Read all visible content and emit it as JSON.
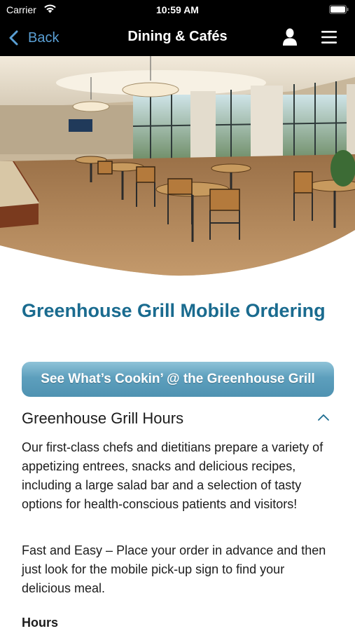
{
  "status_bar": {
    "carrier": "Carrier",
    "time": "10:59 AM",
    "icons": [
      "wifi-icon",
      "battery-icon"
    ]
  },
  "nav": {
    "back_label": "Back",
    "title": "Dining & Cafés",
    "icons": [
      "chevron-left-icon",
      "profile-icon",
      "menu-icon"
    ],
    "accent_color": "#5a9fd4"
  },
  "hero": {
    "description_icon": "cafeteria-photo"
  },
  "content": {
    "heading": "Greenhouse Grill Mobile Ordering",
    "heading_color": "#1a6b8f",
    "cta_label": "See What’s Cookin’ @ the Greenhouse Grill",
    "accordion": {
      "title": "Greenhouse Grill Hours",
      "expanded": true,
      "icon": "chevron-up-icon"
    },
    "paragraph_1": "Our first-class chefs and dietitians prepare a variety of appetizing entrees, snacks and delicious recipes, including a large salad bar and a selection of tasty options for health-conscious patients and visitors!",
    "paragraph_2": "Fast and Easy – Place your order in advance and then just look for the mobile pick-up sign to find your delicious meal.",
    "hours_label": "Hours"
  }
}
